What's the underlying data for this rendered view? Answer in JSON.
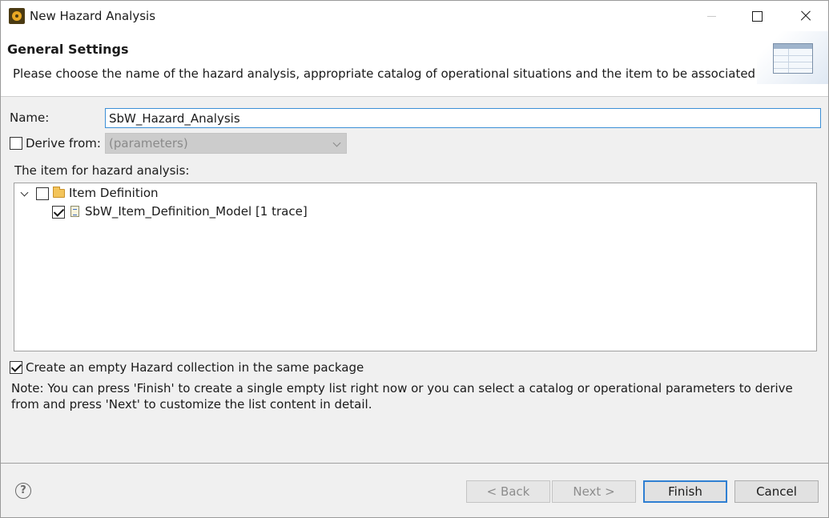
{
  "window": {
    "title": "New Hazard Analysis"
  },
  "banner": {
    "title": "General Settings",
    "description": "Please choose the name of the hazard analysis, appropriate catalog of operational situations and the item to be associated with it."
  },
  "form": {
    "name_label": "Name:",
    "name_value": "SbW_Hazard_Analysis",
    "derive_label": "Derive from:",
    "derive_checked": false,
    "derive_combo_value": "(parameters)",
    "tree_label": "The item for hazard analysis:",
    "create_collection_label": "Create an empty Hazard collection in the same package",
    "create_collection_checked": true,
    "note": "Note: You can press 'Finish' to create a single empty list right now or you can select a catalog or operational parameters to derive from and press 'Next' to customize the list content in detail."
  },
  "tree": {
    "items": [
      {
        "label": "Item Definition",
        "icon": "folder-icon",
        "checked": false,
        "expanded": true
      },
      {
        "label": "SbW_Item_Definition_Model [1 trace]",
        "icon": "document-icon",
        "checked": true
      }
    ]
  },
  "buttons": {
    "back": "< Back",
    "next": "Next >",
    "finish": "Finish",
    "cancel": "Cancel",
    "help": "?"
  },
  "colors": {
    "accent": "#3b8fd6",
    "dialog_bg": "#f0f0f0"
  }
}
